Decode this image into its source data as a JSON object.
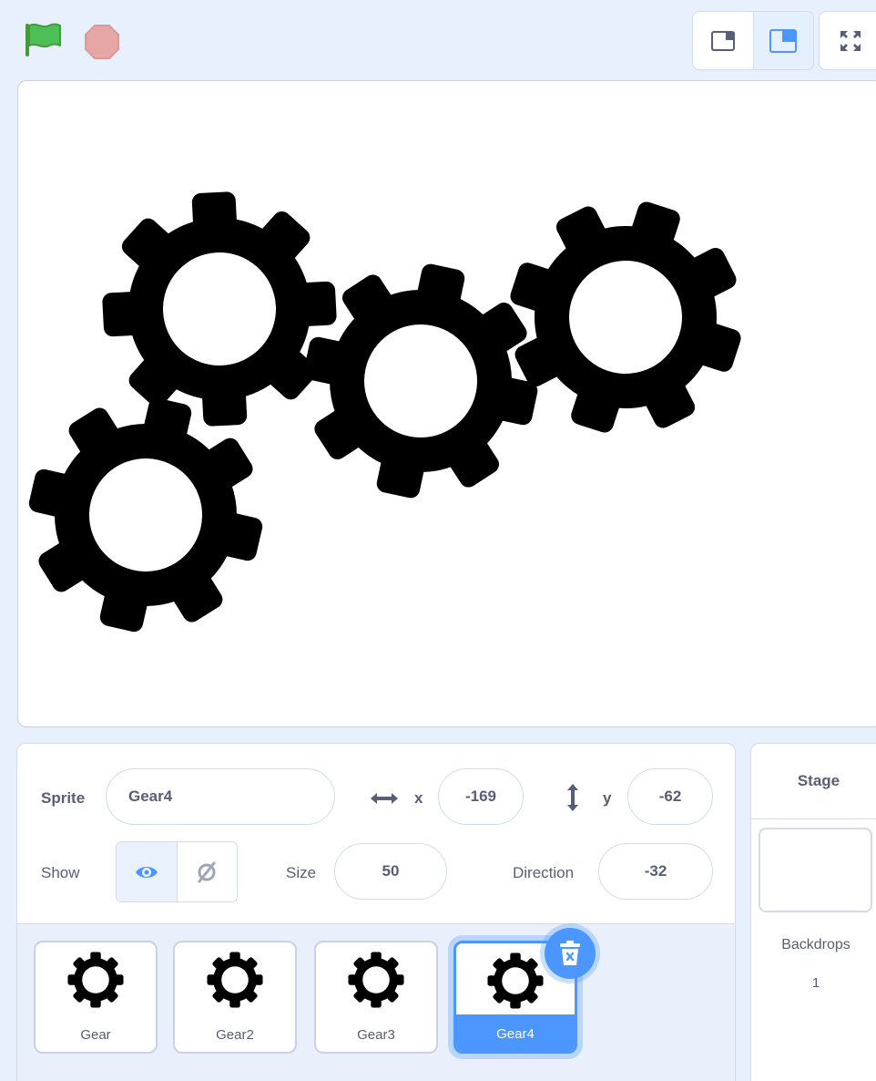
{
  "toolbar": {
    "green_flag_icon": "green-flag-icon",
    "stop_icon": "stop-icon",
    "small_stage_icon": "small-stage-icon",
    "normal_stage_icon": "normal-stage-icon",
    "fullscreen_icon": "fullscreen-icon"
  },
  "colors": {
    "accent": "#4c97ff",
    "flag_green": "#4cbf56",
    "stop_red": "#e6a6a6",
    "text": "#575e75",
    "background": "#e8f0fd"
  },
  "sprite_info": {
    "sprite_label": "Sprite",
    "sprite_name": "Gear4",
    "x_label": "x",
    "x_value": "-169",
    "y_label": "y",
    "y_value": "-62",
    "show_label": "Show",
    "size_label": "Size",
    "size_value": "50",
    "direction_label": "Direction",
    "direction_value": "-32"
  },
  "sprites": [
    {
      "name": "Gear",
      "selected": false
    },
    {
      "name": "Gear2",
      "selected": false
    },
    {
      "name": "Gear3",
      "selected": false
    },
    {
      "name": "Gear4",
      "selected": true
    }
  ],
  "stage_panel": {
    "title": "Stage",
    "backdrops_label": "Backdrops",
    "backdrops_count": "1"
  }
}
